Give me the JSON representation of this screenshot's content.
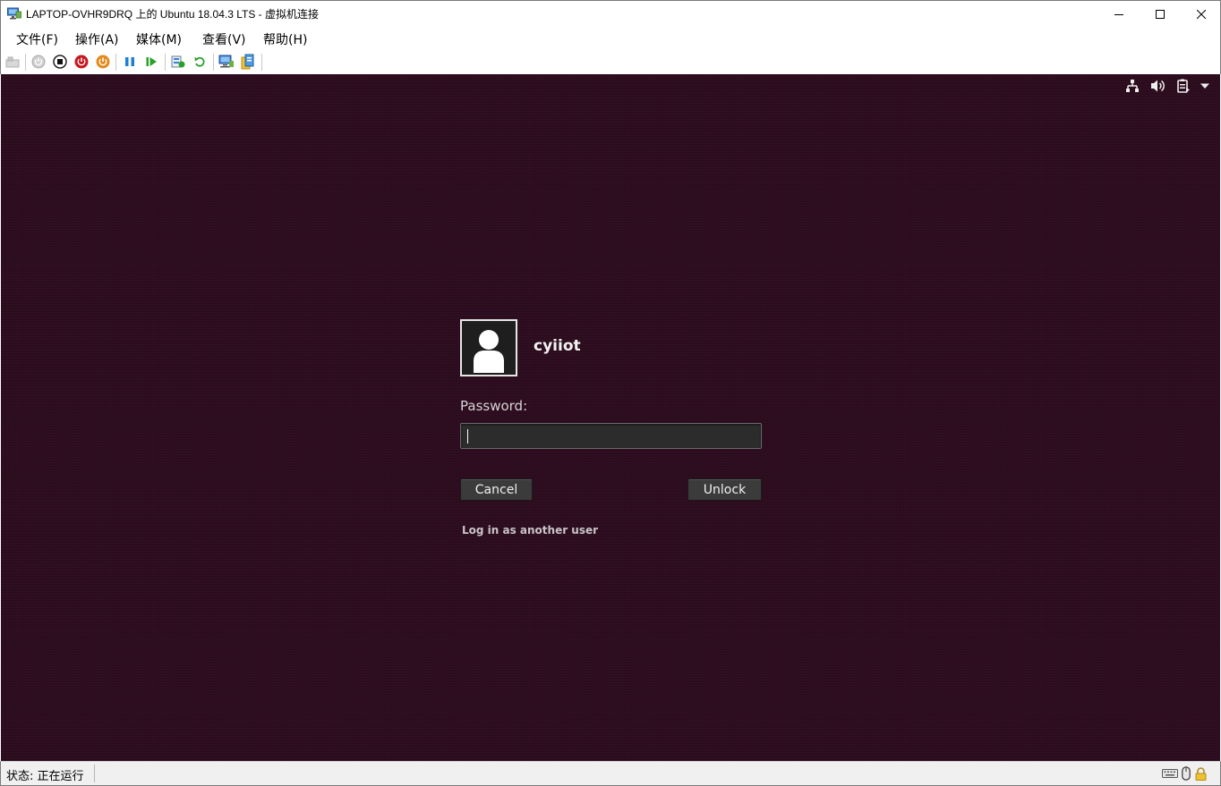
{
  "window": {
    "title": "LAPTOP-OVHR9DRQ 上的 Ubuntu 18.04.3 LTS - 虚拟机连接",
    "app_icon": "hyperv-vm-connect-icon",
    "controls": [
      "minimize-icon",
      "maximize-icon",
      "close-icon"
    ]
  },
  "menubar": {
    "items": [
      {
        "label": "文件(F)"
      },
      {
        "label": "操作(A)"
      },
      {
        "label": "媒体(M)"
      },
      {
        "label": "查看(V)"
      },
      {
        "label": "帮助(H)"
      }
    ]
  },
  "toolbar": {
    "buttons": [
      {
        "name": "ctrl-alt-del-icon",
        "enabled": false
      },
      {
        "name": "start-icon",
        "enabled": false
      },
      {
        "name": "turn-off-icon",
        "enabled": true
      },
      {
        "name": "shut-down-icon",
        "enabled": true
      },
      {
        "name": "save-icon",
        "enabled": true
      },
      {
        "name": "pause-icon",
        "enabled": true
      },
      {
        "name": "resume-icon",
        "enabled": true
      },
      {
        "name": "checkpoint-icon",
        "enabled": true
      },
      {
        "name": "revert-icon",
        "enabled": true
      },
      {
        "name": "enhanced-session-icon",
        "enabled": true
      },
      {
        "name": "share-icon",
        "enabled": true
      }
    ]
  },
  "vm": {
    "background_color": "#2c0c1e",
    "tray_icons": [
      "network-icon",
      "volume-icon",
      "power-icon",
      "dropdown-arrow-icon"
    ],
    "lock_screen": {
      "username": "cyiiot",
      "password_label": "Password:",
      "password_value": "",
      "cancel_label": "Cancel",
      "unlock_label": "Unlock",
      "other_user_label": "Log in as another user"
    }
  },
  "statusbar": {
    "status_text": "状态: 正在运行",
    "icons": [
      "keyboard-icon",
      "mouse-icon",
      "lock-icon"
    ]
  }
}
